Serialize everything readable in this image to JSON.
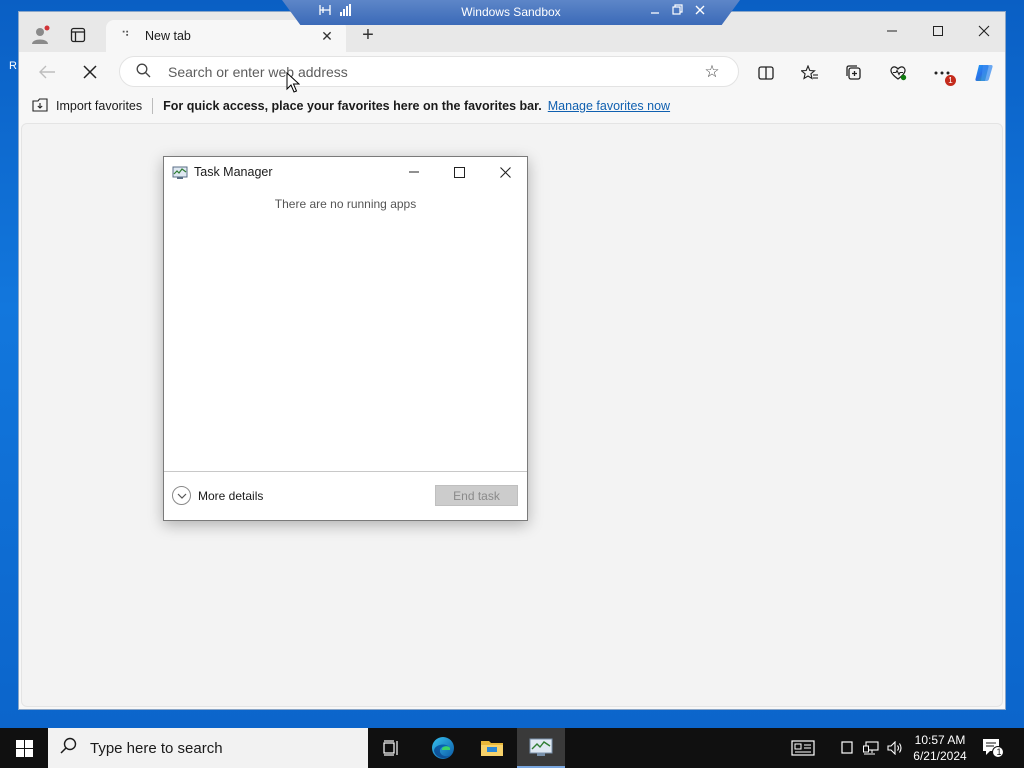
{
  "sandbox": {
    "title": "Windows Sandbox"
  },
  "desktop": {
    "stray_letter": "R"
  },
  "browser": {
    "tab": {
      "title": "New tab"
    },
    "address_bar": {
      "placeholder": "Search or enter web address",
      "value": ""
    },
    "favorites_bar": {
      "import_label": "Import favorites",
      "message": "For quick access, place your favorites here on the favorites bar.",
      "manage_link": "Manage favorites now"
    },
    "menu_badge": "1"
  },
  "task_manager": {
    "title": "Task Manager",
    "empty_message": "There are no running apps",
    "more_details": "More details",
    "end_task": "End task"
  },
  "taskbar": {
    "search_placeholder": "Type here to search",
    "time": "10:57 AM",
    "date": "6/21/2024",
    "notification_count": "1"
  },
  "colors": {
    "desktop": "#0a5fc4",
    "sandbox_bar": "#3b6ab8",
    "taskbar": "#101010",
    "link": "#1060b0",
    "badge": "#c42b1c"
  }
}
